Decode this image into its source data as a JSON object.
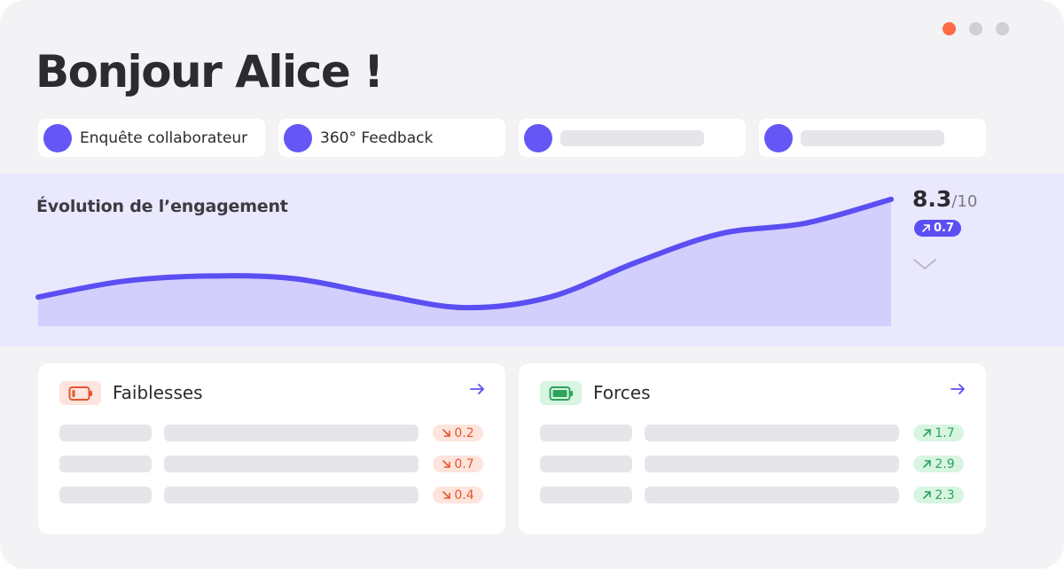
{
  "window": {
    "controls": [
      "red-dot",
      "grey-dot",
      "grey-dot"
    ]
  },
  "greeting": "Bonjour Alice !",
  "shortcuts": [
    {
      "label": "Enquête collaborateur"
    },
    {
      "label": "360° Feedback"
    },
    {
      "label": ""
    },
    {
      "label": ""
    }
  ],
  "engagement": {
    "title": "Évolution de l’engagement",
    "score": "8.3",
    "score_max": "/10",
    "delta": "0.7",
    "delta_icon": "arrow-up-right-icon",
    "expand_icon": "chevron-down-icon"
  },
  "chart_data": {
    "type": "area",
    "title": "Évolution de l’engagement",
    "xlabel": "",
    "ylabel": "",
    "x": [
      0,
      1,
      2,
      3,
      4,
      5,
      6,
      7,
      8,
      9,
      10
    ],
    "values": [
      4.6,
      5.2,
      5.4,
      5.3,
      4.7,
      4.2,
      4.6,
      5.9,
      7.0,
      7.4,
      8.3
    ],
    "ylim": [
      3.5,
      8.6
    ],
    "grid": false,
    "line_color": "#5b4ef2",
    "fill_color": "#d2cffc"
  },
  "weaknesses": {
    "title": "Faiblesses",
    "icon": "battery-low-icon",
    "accent": "#e4572e",
    "items": [
      {
        "delta": "0.2"
      },
      {
        "delta": "0.7"
      },
      {
        "delta": "0.4"
      }
    ]
  },
  "strengths": {
    "title": "Forces",
    "icon": "battery-full-icon",
    "accent": "#2ea35a",
    "items": [
      {
        "delta": "1.7"
      },
      {
        "delta": "2.9"
      },
      {
        "delta": "2.3"
      }
    ]
  },
  "colors": {
    "brand": "#6557f6",
    "background": "#f3f3f6",
    "chart_band": "#e9e8fd"
  }
}
